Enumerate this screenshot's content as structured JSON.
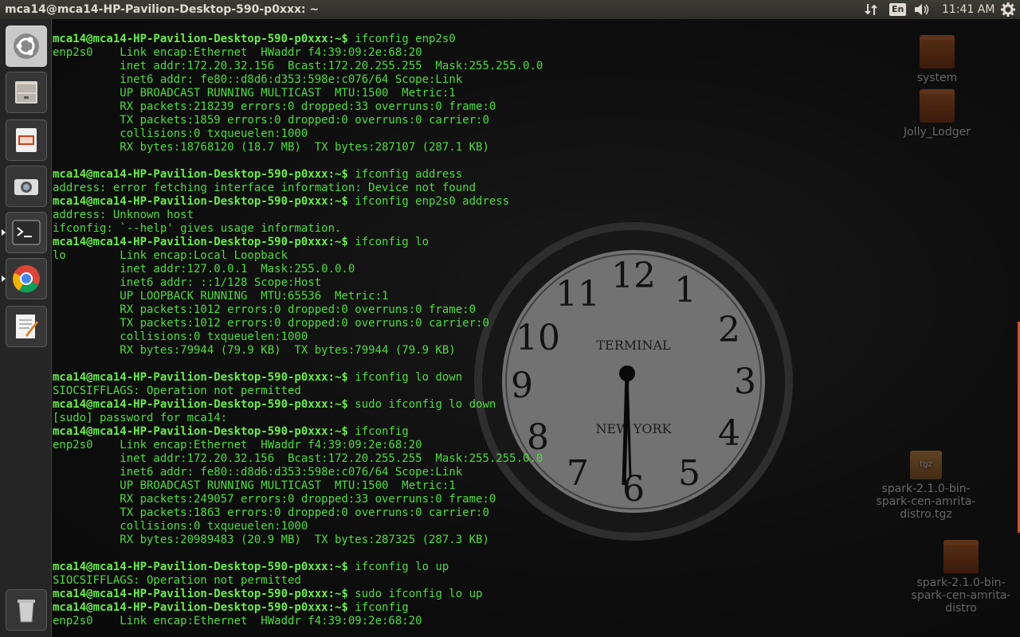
{
  "top_panel": {
    "window_title": "mca14@mca14-HP-Pavilion-Desktop-590-p0xxx: ~",
    "keyboard_layout": "En",
    "clock": "11:41 AM",
    "icons": [
      "network-icon",
      "volume-icon",
      "settings-gear-icon"
    ]
  },
  "launcher": {
    "items": [
      {
        "name": "ubuntu-dash",
        "icon": "ubuntu-logo-icon"
      },
      {
        "name": "files",
        "icon": "file-cabinet-icon"
      },
      {
        "name": "libreoffice-impress",
        "icon": "presentation-icon"
      },
      {
        "name": "screenshot",
        "icon": "camera-icon"
      },
      {
        "name": "terminal",
        "icon": "terminal-icon",
        "active": true
      },
      {
        "name": "chrome",
        "icon": "chrome-icon",
        "active": true
      },
      {
        "name": "text-editor",
        "icon": "text-editor-icon"
      },
      {
        "name": "trash",
        "icon": "trash-icon"
      }
    ]
  },
  "desktop": {
    "icons": [
      {
        "label": "system",
        "type": "folder"
      },
      {
        "label": "Jolly_Lodger",
        "type": "folder"
      },
      {
        "label": "spark-2.1.0-bin-spark-cen-amrita-distro.tgz",
        "type": "archive",
        "badge": "tgz"
      },
      {
        "label": "spark-2.1.0-bin-spark-cen-amrita-distro",
        "type": "folder"
      }
    ]
  },
  "terminal": {
    "prompt": "mca14@mca14-HP-Pavilion-Desktop-590-p0xxx:~$",
    "lines": [
      {
        "type": "prompt",
        "cmd": " ifconfig enp2s0"
      },
      {
        "type": "out",
        "text": "enp2s0    Link encap:Ethernet  HWaddr f4:39:09:2e:68:20"
      },
      {
        "type": "out",
        "text": "          inet addr:172.20.32.156  Bcast:172.20.255.255  Mask:255.255.0.0"
      },
      {
        "type": "out",
        "text": "          inet6 addr: fe80::d8d6:d353:598e:c076/64 Scope:Link"
      },
      {
        "type": "out",
        "text": "          UP BROADCAST RUNNING MULTICAST  MTU:1500  Metric:1"
      },
      {
        "type": "out",
        "text": "          RX packets:218239 errors:0 dropped:33 overruns:0 frame:0"
      },
      {
        "type": "out",
        "text": "          TX packets:1859 errors:0 dropped:0 overruns:0 carrier:0"
      },
      {
        "type": "out",
        "text": "          collisions:0 txqueuelen:1000"
      },
      {
        "type": "out",
        "text": "          RX bytes:18768120 (18.7 MB)  TX bytes:287107 (287.1 KB)"
      },
      {
        "type": "out",
        "text": ""
      },
      {
        "type": "prompt",
        "cmd": " ifconfig address"
      },
      {
        "type": "out",
        "text": "address: error fetching interface information: Device not found"
      },
      {
        "type": "prompt",
        "cmd": " ifconfig enp2s0 address"
      },
      {
        "type": "out",
        "text": "address: Unknown host"
      },
      {
        "type": "out",
        "text": "ifconfig: `--help' gives usage information."
      },
      {
        "type": "prompt",
        "cmd": " ifconfig lo"
      },
      {
        "type": "out",
        "text": "lo        Link encap:Local Loopback"
      },
      {
        "type": "out",
        "text": "          inet addr:127.0.0.1  Mask:255.0.0.0"
      },
      {
        "type": "out",
        "text": "          inet6 addr: ::1/128 Scope:Host"
      },
      {
        "type": "out",
        "text": "          UP LOOPBACK RUNNING  MTU:65536  Metric:1"
      },
      {
        "type": "out",
        "text": "          RX packets:1012 errors:0 dropped:0 overruns:0 frame:0"
      },
      {
        "type": "out",
        "text": "          TX packets:1012 errors:0 dropped:0 overruns:0 carrier:0"
      },
      {
        "type": "out",
        "text": "          collisions:0 txqueuelen:1000"
      },
      {
        "type": "out",
        "text": "          RX bytes:79944 (79.9 KB)  TX bytes:79944 (79.9 KB)"
      },
      {
        "type": "out",
        "text": ""
      },
      {
        "type": "prompt",
        "cmd": " ifconfig lo down"
      },
      {
        "type": "out",
        "text": "SIOCSIFFLAGS: Operation not permitted"
      },
      {
        "type": "prompt",
        "cmd": " sudo ifconfig lo down"
      },
      {
        "type": "out",
        "text": "[sudo] password for mca14:"
      },
      {
        "type": "prompt",
        "cmd": " ifconfig"
      },
      {
        "type": "out",
        "text": "enp2s0    Link encap:Ethernet  HWaddr f4:39:09:2e:68:20"
      },
      {
        "type": "out",
        "text": "          inet addr:172.20.32.156  Bcast:172.20.255.255  Mask:255.255.0.0"
      },
      {
        "type": "out",
        "text": "          inet6 addr: fe80::d8d6:d353:598e:c076/64 Scope:Link"
      },
      {
        "type": "out",
        "text": "          UP BROADCAST RUNNING MULTICAST  MTU:1500  Metric:1"
      },
      {
        "type": "out",
        "text": "          RX packets:249057 errors:0 dropped:33 overruns:0 frame:0"
      },
      {
        "type": "out",
        "text": "          TX packets:1863 errors:0 dropped:0 overruns:0 carrier:0"
      },
      {
        "type": "out",
        "text": "          collisions:0 txqueuelen:1000"
      },
      {
        "type": "out",
        "text": "          RX bytes:20989483 (20.9 MB)  TX bytes:287325 (287.3 KB)"
      },
      {
        "type": "out",
        "text": ""
      },
      {
        "type": "prompt",
        "cmd": " ifconfig lo up"
      },
      {
        "type": "out",
        "text": "SIOCSIFFLAGS: Operation not permitted"
      },
      {
        "type": "prompt",
        "cmd": " sudo ifconfig lo up"
      },
      {
        "type": "prompt",
        "cmd": " ifconfig"
      },
      {
        "type": "out",
        "text": "enp2s0    Link encap:Ethernet  HWaddr f4:39:09:2e:68:20"
      }
    ]
  },
  "colors": {
    "terminal_text": "#4bdf3a",
    "prompt_text": "#67ef44",
    "panel_bg": "#2f2e2a",
    "launcher_bg": "#282828"
  }
}
